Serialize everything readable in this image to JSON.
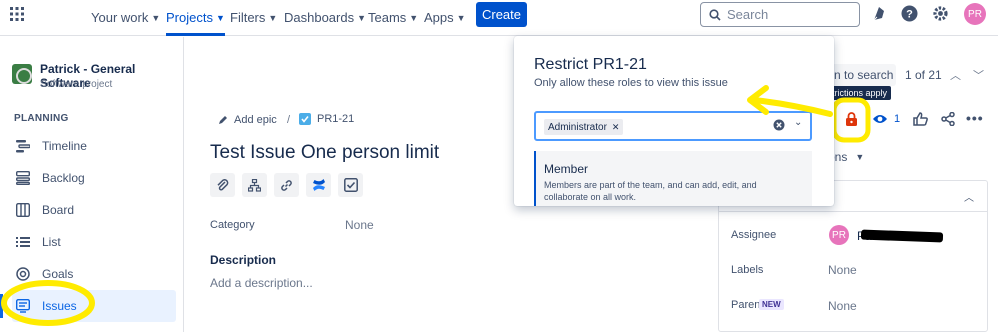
{
  "topnav": {
    "items": [
      {
        "label": "Your work"
      },
      {
        "label": "Projects"
      },
      {
        "label": "Filters"
      },
      {
        "label": "Dashboards"
      },
      {
        "label": "Teams"
      },
      {
        "label": "Apps"
      }
    ],
    "create_label": "Create",
    "search_placeholder": "Search",
    "avatar_initials": "PR"
  },
  "sidebar": {
    "project_name": "Patrick - General Software",
    "project_type": "Software project",
    "section": "PLANNING",
    "items": [
      {
        "label": "Timeline"
      },
      {
        "label": "Backlog"
      },
      {
        "label": "Board"
      },
      {
        "label": "List"
      },
      {
        "label": "Goals"
      },
      {
        "label": "Issues"
      }
    ]
  },
  "issue": {
    "add_epic": "Add epic",
    "key": "PR1-21",
    "title": "Test Issue One person limit",
    "category_label": "Category",
    "category_value": "None",
    "description_label": "Description",
    "description_placeholder": "Add a description..."
  },
  "popup": {
    "title": "Restrict PR1-21",
    "subtitle": "Only allow these roles to view this issue",
    "selected_role": "Administrator",
    "option_title": "Member",
    "option_desc": "Members are part of the team, and can add, edit, and collaborate on all work."
  },
  "right": {
    "return_label": "rn to search",
    "pager": "1 of 21",
    "tooltip": "Restrictions apply",
    "watch_count": "1",
    "actions_label": "tions",
    "assignee_label": "Assignee",
    "assignee_initials": "PR",
    "assignee_name": "Patric",
    "labels_label": "Labels",
    "labels_value": "None",
    "parent_label": "Parent",
    "parent_badge": "NEW",
    "parent_value": "None"
  },
  "colors": {
    "brand": "#0052cc",
    "highlight": "#ffeb00",
    "avatar": "#e774bb",
    "lock": "#de350b"
  }
}
